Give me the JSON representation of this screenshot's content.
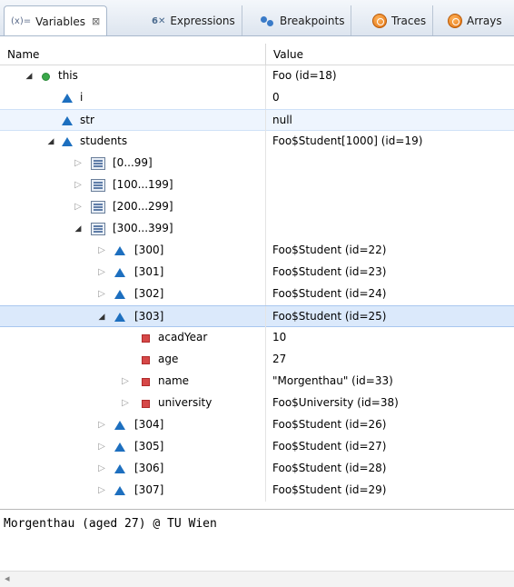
{
  "tabs": [
    {
      "label": "Variables",
      "prefix": "(x)=",
      "close": "⊠",
      "active": true
    },
    {
      "label": "Expressions",
      "prefix": "6✕"
    },
    {
      "label": "Breakpoints"
    },
    {
      "label": "Traces"
    },
    {
      "label": "Arrays"
    }
  ],
  "columns": {
    "name": "Name",
    "value": "Value"
  },
  "rows": [
    {
      "name": "this",
      "value": "Foo  (id=18)"
    },
    {
      "name": "i",
      "value": "0"
    },
    {
      "name": "str",
      "value": "null"
    },
    {
      "name": "students",
      "value": "Foo$Student[1000]  (id=19)"
    },
    {
      "name": "[0...99]",
      "value": ""
    },
    {
      "name": "[100...199]",
      "value": ""
    },
    {
      "name": "[200...299]",
      "value": ""
    },
    {
      "name": "[300...399]",
      "value": ""
    },
    {
      "name": "[300]",
      "value": "Foo$Student  (id=22)"
    },
    {
      "name": "[301]",
      "value": "Foo$Student  (id=23)"
    },
    {
      "name": "[302]",
      "value": "Foo$Student  (id=24)"
    },
    {
      "name": "[303]",
      "value": "Foo$Student  (id=25)"
    },
    {
      "name": "acadYear",
      "value": "10"
    },
    {
      "name": "age",
      "value": "27"
    },
    {
      "name": "name",
      "value": "\"Morgenthau\" (id=33)"
    },
    {
      "name": "university",
      "value": "Foo$University  (id=38)"
    },
    {
      "name": "[304]",
      "value": "Foo$Student  (id=26)"
    },
    {
      "name": "[305]",
      "value": "Foo$Student  (id=27)"
    },
    {
      "name": "[306]",
      "value": "Foo$Student  (id=28)"
    },
    {
      "name": "[307]",
      "value": "Foo$Student  (id=29)"
    }
  ],
  "detail": {
    "text": "Morgenthau (aged 27) @ TU Wien"
  },
  "scroll": {
    "left_arrow": "◂"
  }
}
